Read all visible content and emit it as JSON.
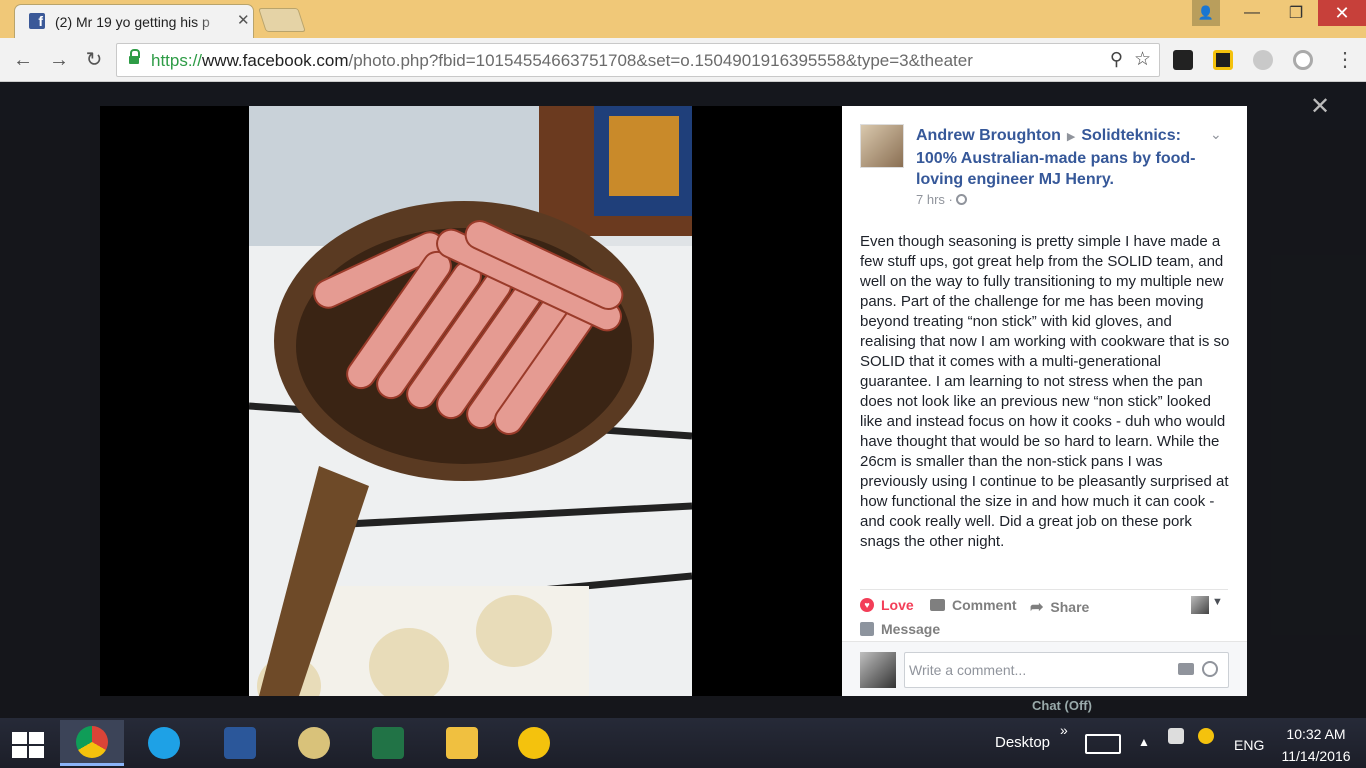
{
  "browser": {
    "tab_title": "(2) Mr 19 yo getting his p",
    "tab_favicon_letter": "f",
    "url_protocol": "https://",
    "url_host": "www.facebook.com",
    "url_path": "/photo.php?fbid=10154554663751708&set=o.1504901916395558&type=3&theater"
  },
  "post": {
    "author": "Andrew Broughton",
    "target": "Solidteknics: 100% Australian-made pans by food-loving engineer MJ Henry.",
    "time": "7 hrs",
    "time_sep": "·",
    "text": "Even though seasoning is pretty simple I have made a few stuff ups, got great help from the SOLID team, and well on the way to fully transitioning to my multiple new pans. Part of the challenge for me has been moving beyond treating “non stick” with kid gloves, and realising that now I am working with cookware that is so SOLID that it comes with a multi-generational guarantee. I am learning to not stress when the pan does not look like an previous new “non stick” looked like and instead focus on how it cooks - duh who would have thought that would be so hard to learn. While the 26cm is smaller than the non-stick pans I was previously using I continue to be pleasantly surprised at how functional the size in and how much it can cook - and cook really well. Did a great job on these pork snags the other night."
  },
  "actions": {
    "love": "Love",
    "comment": "Comment",
    "share": "Share",
    "message": "Message"
  },
  "comment_box": {
    "placeholder": "Write a comment..."
  },
  "facebook": {
    "chat_status": "Chat (Off)"
  },
  "taskbar": {
    "desktop_label": "Desktop",
    "overflow": "»",
    "language": "ENG",
    "time": "10:32 AM",
    "date": "11/14/2016"
  },
  "colors": {
    "facebook_blue": "#365899",
    "love_red": "#f33e58",
    "title_bar": "#f0c878",
    "close_red": "#c7403a"
  }
}
